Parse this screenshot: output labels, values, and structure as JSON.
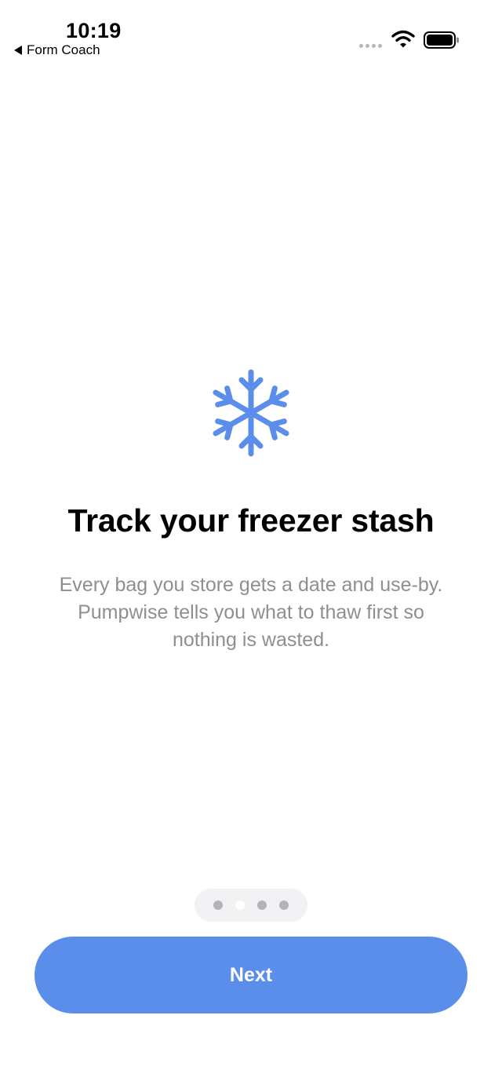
{
  "status_bar": {
    "time": "10:19",
    "back_label": "Form Coach"
  },
  "onboarding": {
    "icon": "snowflake-icon",
    "title": "Track your freezer stash",
    "description": "Every bag you store gets a date and use-by. Pumpwise tells you what to thaw first so nothing is wasted.",
    "page_count": 4,
    "current_page": 2,
    "next_label": "Next"
  },
  "colors": {
    "accent": "#5b8eea",
    "title_text": "#000000",
    "body_text": "#8e8e93",
    "indicator_bg": "#f2f2f4"
  }
}
